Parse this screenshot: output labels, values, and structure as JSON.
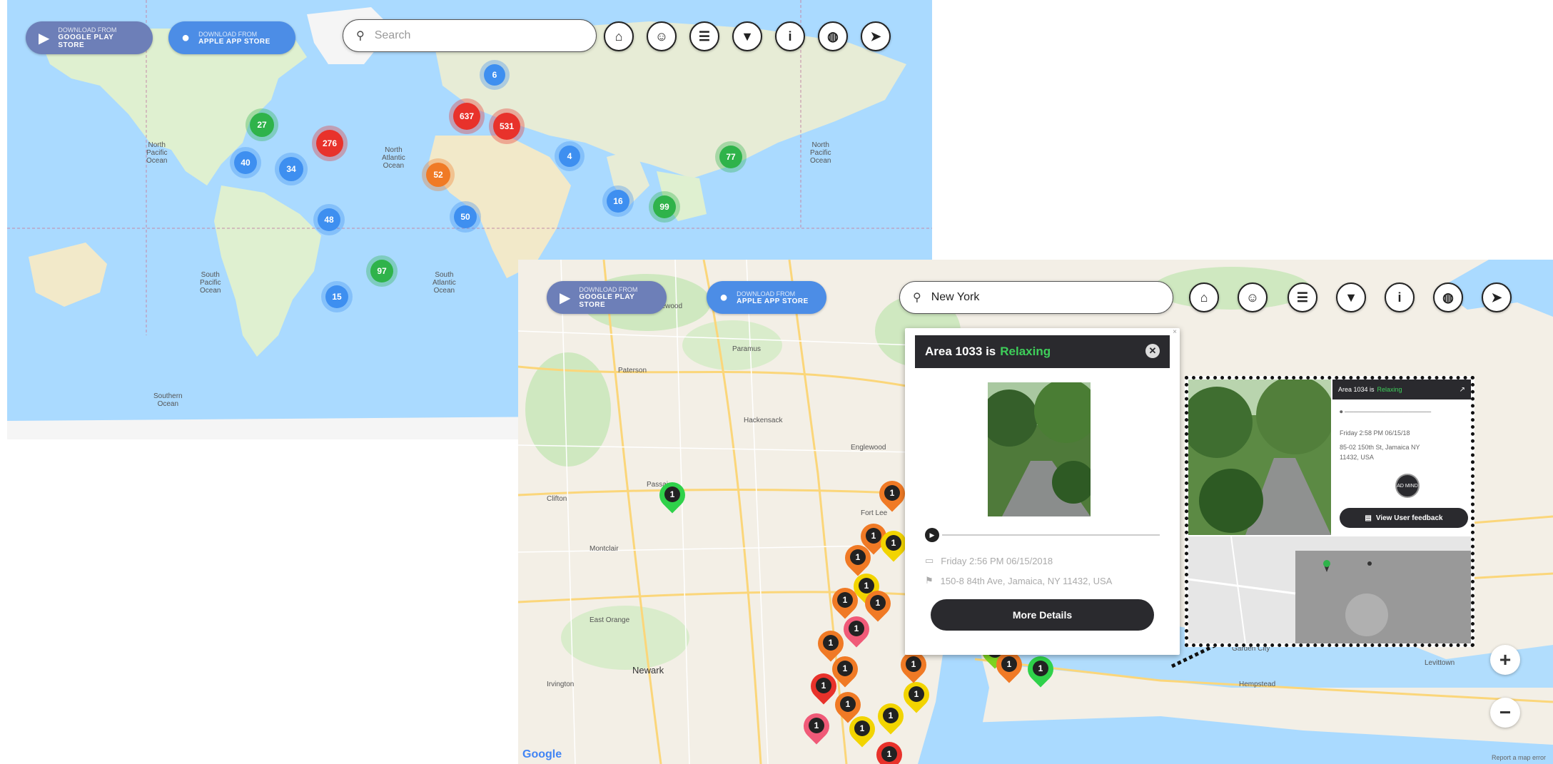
{
  "world": {
    "search": {
      "value": "",
      "placeholder": "Search"
    },
    "stores": {
      "google": {
        "small": "DOWNLOAD FROM",
        "big": "GOOGLE PLAY STORE"
      },
      "apple": {
        "small": "DOWNLOAD FROM",
        "big": "APPLE APP STORE"
      }
    },
    "clusters": [
      {
        "label": "27",
        "color": "green"
      },
      {
        "label": "276",
        "color": "red"
      },
      {
        "label": "40",
        "color": "blue"
      },
      {
        "label": "34",
        "color": "blue"
      },
      {
        "label": "48",
        "color": "blue"
      },
      {
        "label": "15",
        "color": "blue"
      },
      {
        "label": "97",
        "color": "green"
      },
      {
        "label": "6",
        "color": "blue"
      },
      {
        "label": "637",
        "color": "red"
      },
      {
        "label": "531",
        "color": "red"
      },
      {
        "label": "52",
        "color": "orange"
      },
      {
        "label": "50",
        "color": "blue"
      },
      {
        "label": "4",
        "color": "blue"
      },
      {
        "label": "16",
        "color": "blue"
      },
      {
        "label": "99",
        "color": "green"
      },
      {
        "label": "77",
        "color": "green"
      }
    ],
    "labels": {
      "north_pacific": "North\nPacific\nOcean",
      "north_atlantic": "North\nAtlantic\nOcean",
      "south_pacific": "South\nPacific\nOcean",
      "south_atlantic": "South\nAtlantic\nOcean",
      "north_pacific_east": "North\nPacific\nOcean",
      "southern": "Southern\nOcean"
    }
  },
  "nyc": {
    "search": {
      "value": "New York",
      "placeholder": ""
    },
    "stores": {
      "google": {
        "small": "DOWNLOAD FROM",
        "big": "GOOGLE PLAY STORE"
      },
      "apple": {
        "small": "DOWNLOAD FROM",
        "big": "APPLE APP STORE"
      }
    },
    "places": {
      "paterson": "Paterson",
      "newark": "Newark",
      "hackensack": "Hackensack",
      "hempstead": "Hempstead",
      "fort_lee": "Fort Lee",
      "passaic": "Passaic",
      "east_orange": "East Orange",
      "englewood": "Englewood",
      "clifton": "Clifton",
      "ridgewood": "Ridgewood",
      "paramus": "Paramus",
      "montclair": "Montclair",
      "irvington": "Irvington",
      "garden_city": "Garden City",
      "levittown": "Levittown"
    },
    "pin_label": "1",
    "google": "Google",
    "footer": "Report a map error"
  },
  "popup": {
    "title_prefix": "Area 1033 is",
    "status": "Relaxing",
    "date": "Friday 2:56 PM 06/15/2018",
    "address": "150-8 84th Ave, Jamaica, NY 11432, USA",
    "more_details": "More Details"
  },
  "inset": {
    "title_prefix": "Area 1034 is",
    "status": "Relaxing",
    "date": "Friday 2:58 PM 06/15/18",
    "address": "85-02 150th St, Jamaica NY",
    "address2": "11432, USA",
    "avatar": "AD MIND",
    "feedback": "View User feedback"
  },
  "colors": {
    "water": "#aadaff",
    "land": "#f3efe6",
    "dark": "#2a2a2e",
    "relaxing": "#3ecf5a"
  }
}
